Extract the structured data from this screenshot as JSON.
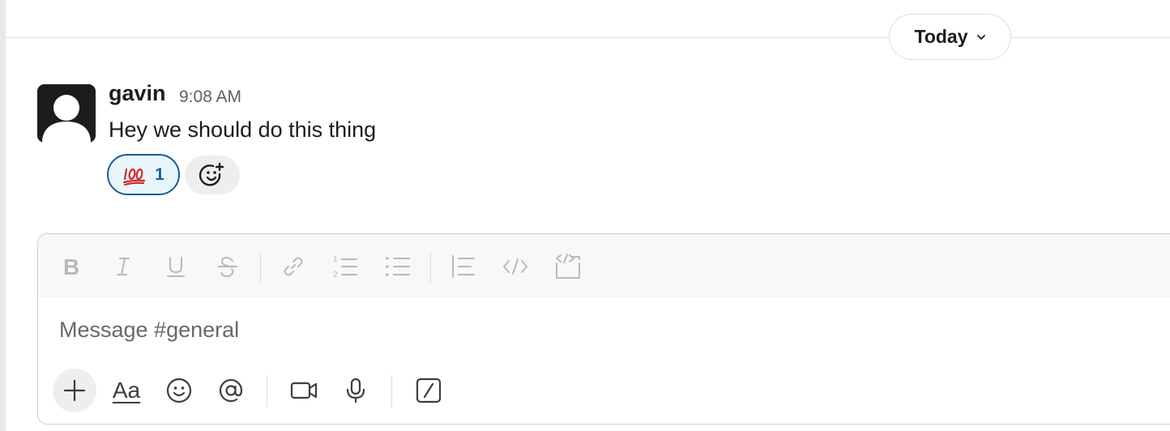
{
  "date_divider": {
    "label": "Today"
  },
  "message": {
    "author": "gavin",
    "time": "9:08 AM",
    "text": "Hey we should do this thing",
    "reaction": {
      "emoji": "hundred-points-emoji",
      "count": "1"
    }
  },
  "composer": {
    "placeholder": "Message #general",
    "value": "",
    "formatting_buttons": [
      "bold-icon",
      "italic-icon",
      "underline-icon",
      "strikethrough-icon",
      "link-icon",
      "ordered-list-icon",
      "bulleted-list-icon",
      "blockquote-icon",
      "code-icon",
      "code-block-icon"
    ],
    "action_buttons": [
      "plus-icon",
      "text-format-icon",
      "emoji-icon",
      "mention-icon",
      "video-icon",
      "microphone-icon",
      "slash-command-icon"
    ],
    "text_format_glyph": "Aa"
  },
  "colors": {
    "reaction_border": "#1d5a9b",
    "reaction_background": "#e8f5fa",
    "reaction_count": "#1264a3",
    "toolbar_icon_disabled": "#b9b9b9",
    "action_icon": "#3d3d3d"
  }
}
